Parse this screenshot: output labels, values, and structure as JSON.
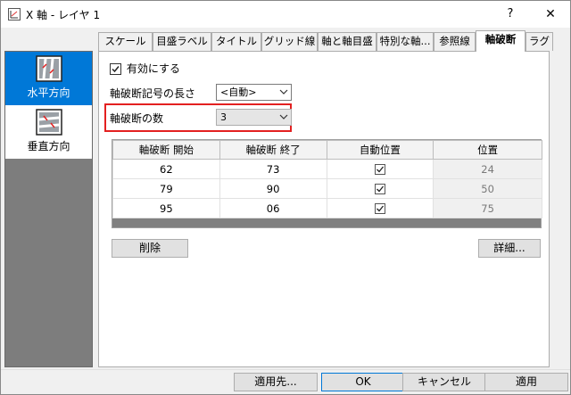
{
  "window": {
    "title": "X 軸 - レイヤ 1",
    "help": "?",
    "close": "✕",
    "icon": "xaxis-app-icon"
  },
  "left_panel": {
    "items": [
      {
        "label": "水平方向",
        "icon": "horizontal-break-icon",
        "selected": true
      },
      {
        "label": "垂直方向",
        "icon": "vertical-break-icon",
        "selected": false
      }
    ]
  },
  "tabs": [
    {
      "label": "スケール"
    },
    {
      "label": "目盛ラベル"
    },
    {
      "label": "タイトル"
    },
    {
      "label": "グリッド線"
    },
    {
      "label": "軸と軸目盛"
    },
    {
      "label": "特別な軸..."
    },
    {
      "label": "参照線"
    },
    {
      "label": "軸破断",
      "active": true
    },
    {
      "label": "ラグ"
    }
  ],
  "form": {
    "enable_label": "有効にする",
    "enable_checked": true,
    "break_symbol_length_label": "軸破断記号の長さ",
    "break_symbol_length_value": "<自動>",
    "num_breaks_label": "軸破断の数",
    "num_breaks_value": "3"
  },
  "table": {
    "headers": [
      "軸破断 開始",
      "軸破断 終了",
      "自動位置",
      "位置"
    ],
    "rows": [
      {
        "start": "62",
        "end": "73",
        "auto": true,
        "position": "24"
      },
      {
        "start": "79",
        "end": "90",
        "auto": true,
        "position": "50"
      },
      {
        "start": "95",
        "end": "06",
        "auto": true,
        "position": "75"
      }
    ]
  },
  "buttons": {
    "delete": "削除",
    "details": "詳細...",
    "apply_to": "適用先...",
    "ok": "OK",
    "cancel": "キャンセル",
    "apply": "適用"
  },
  "colors": {
    "selection": "#0078d7",
    "highlight_box": "#e32020"
  }
}
